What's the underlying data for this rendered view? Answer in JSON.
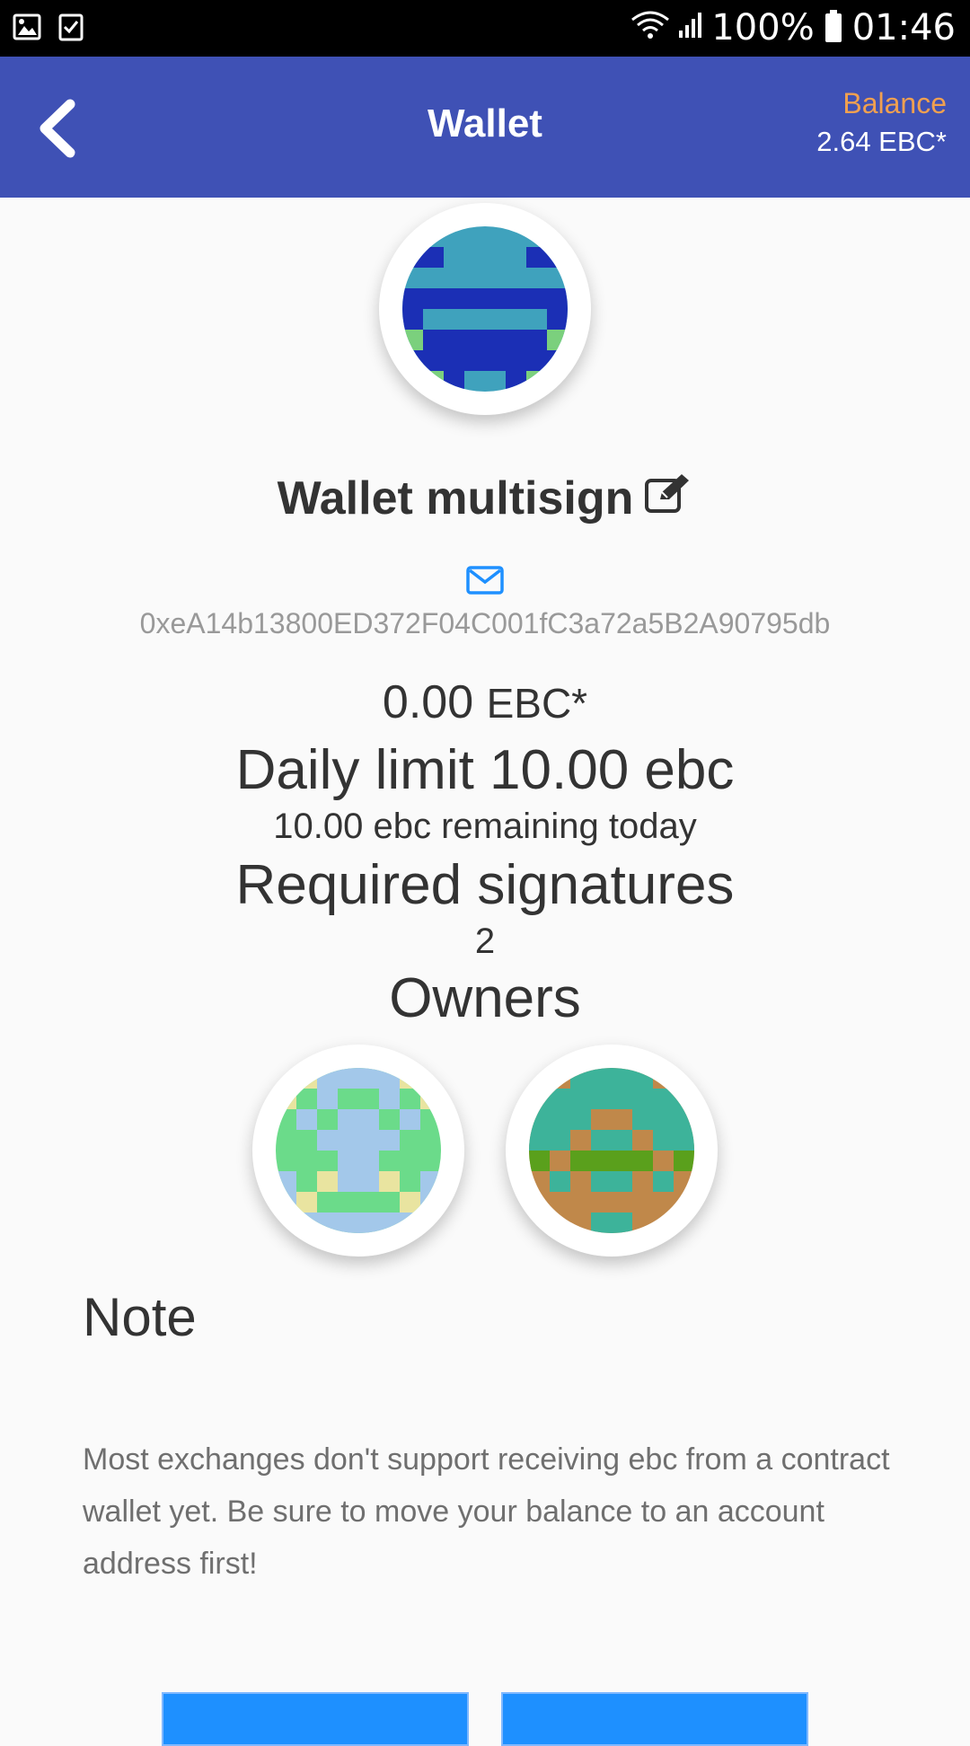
{
  "status_bar": {
    "battery_percent": "100%",
    "time": "01:46",
    "icons": [
      "image-icon",
      "task-icon",
      "wifi-icon",
      "signal-icon",
      "battery-icon"
    ]
  },
  "app_bar": {
    "title": "Wallet",
    "balance_label": "Balance",
    "balance_value": "2.64 EBC*",
    "back_icon": "chevron-left-icon"
  },
  "wallet": {
    "name": "Wallet multisign",
    "address": "0xeA14b13800ED372F04C001fC3a72a5B2A90795db",
    "amount": "0.00",
    "amount_unit": "EBC*",
    "daily_limit": "Daily limit 10.00 ebc",
    "remaining": "10.00 ebc remaining today",
    "required_signatures_label": "Required signatures",
    "required_signatures_value": "2",
    "owners_label": "Owners"
  },
  "note": {
    "title": "Note",
    "body": "Most exchanges don't support receiving ebc from a contract wallet yet. Be sure to move your balance to an account address first!"
  },
  "colors": {
    "app_bar": "#3f51b5",
    "balance_label": "#f0a050",
    "accent": "#1e90ff"
  }
}
